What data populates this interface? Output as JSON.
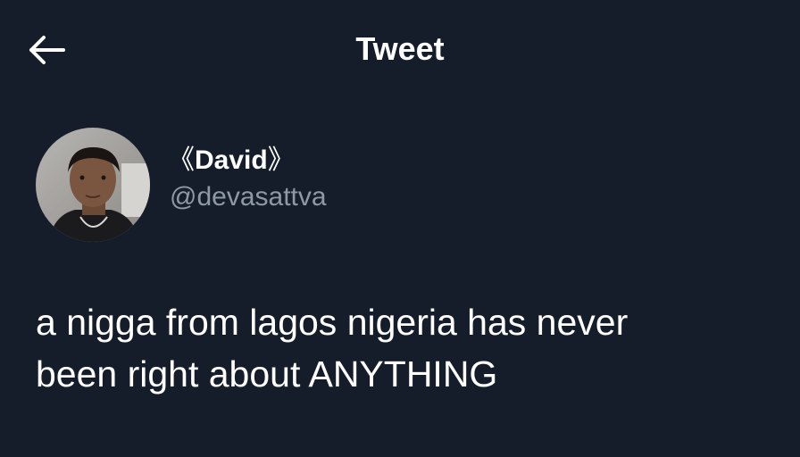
{
  "header": {
    "title": "Tweet",
    "back_icon": "arrow-left-icon"
  },
  "author": {
    "display_name": "David",
    "name_prefix": "《",
    "name_suffix": "》",
    "handle": "@devasattva",
    "avatar_icon": "profile-photo"
  },
  "tweet": {
    "line1": "a nigga from lagos nigeria has never",
    "line2": "been right about ANYTHING"
  },
  "colors": {
    "background": "#161d2a",
    "text": "#ffffff",
    "secondary_text": "#8e99a6"
  }
}
